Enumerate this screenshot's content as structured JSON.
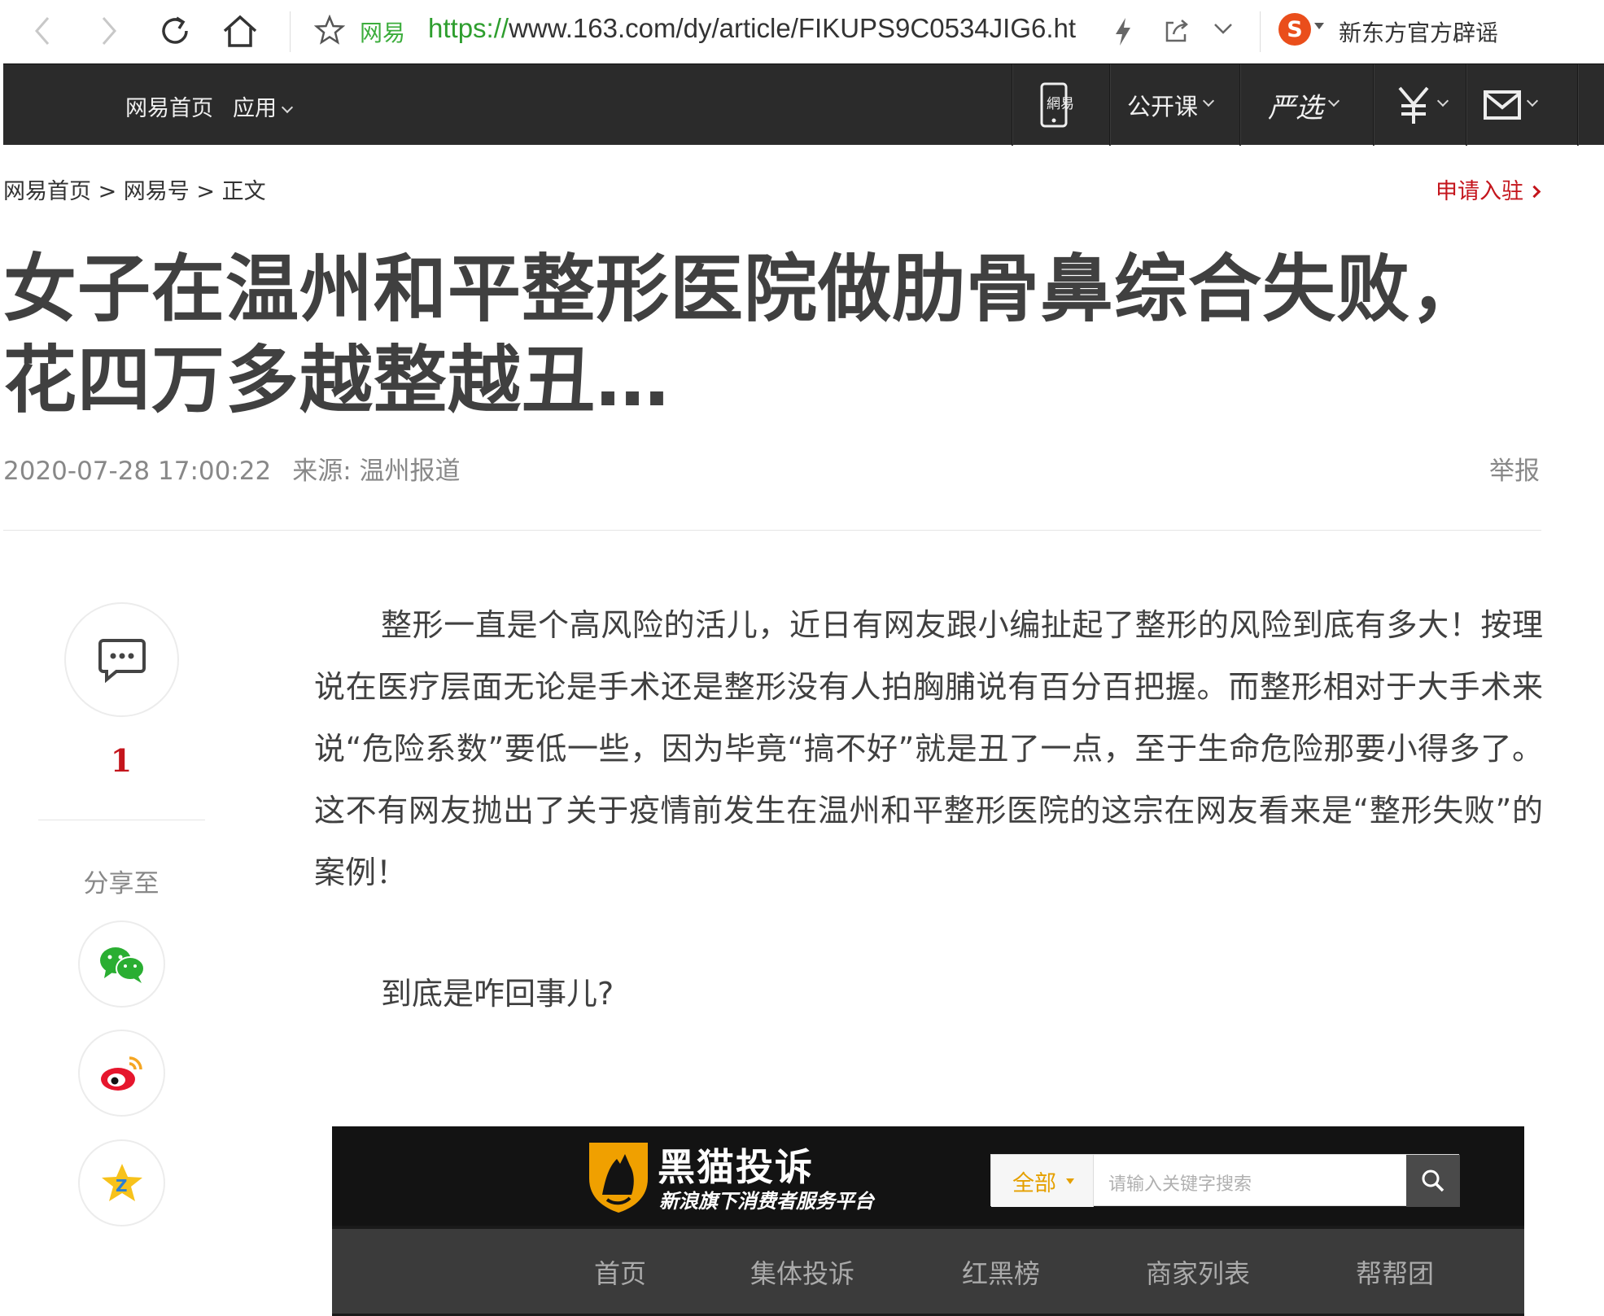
{
  "browser": {
    "site_label": "网易",
    "url_scheme": "https://",
    "url_rest": "www.163.com/dy/article/FIKUPS9C0534JIG6.ht",
    "search_engine_icon": "sogou-icon",
    "hot_search": "新东方官方辟谣"
  },
  "site_nav": {
    "home": "网易首页",
    "apps": "应用",
    "open_course": "公开课",
    "yanxuan": "严选",
    "mobile_icon": "netease-mobile-icon",
    "money_icon": "yuan-icon",
    "mail_icon": "mail-icon"
  },
  "breadcrumb": {
    "home": "网易首页",
    "sep1": " > ",
    "section": "网易号",
    "sep2": " > ",
    "current": "正文"
  },
  "apply_link": "申请入驻",
  "article": {
    "title": "女子在温州和平整形医院做肋骨鼻综合失败，花四万多越整越丑…",
    "datetime": "2020-07-28 17:00:22",
    "source": "来源: 温州报道",
    "report": "举报",
    "paragraph1": "整形一直是个高风险的活儿，近日有网友跟小编扯起了整形的风险到底有多大！按理说在医疗层面无论是手术还是整形没有人拍胸脯说有百分百把握。而整形相对于大手术来说“危险系数”要低一些，因为毕竟“搞不好”就是丑了一点，至于生命危险那要小得多了。这不有网友抛出了关于疫情前发生在温州和平整形医院的这宗在网友看来是“整形失败”的案例！",
    "paragraph2": "到底是咋回事儿?"
  },
  "share_rail": {
    "comment_count": "1",
    "share_label": "分享至",
    "icons": [
      "wechat-icon",
      "weibo-icon",
      "qzone-icon"
    ]
  },
  "embed": {
    "brand": "黑猫投诉",
    "tagline": "新浪旗下消费者服务平台",
    "scope": "全部",
    "placeholder": "请输入关键字搜索",
    "nav": [
      "首页",
      "集体投诉",
      "红黑榜",
      "商家列表",
      "帮帮团"
    ]
  },
  "colors": {
    "nav_bg": "#2b2b2b",
    "accent_red": "#c4151c",
    "url_green": "#2e9e2e",
    "embed_orange": "#e5a000"
  }
}
